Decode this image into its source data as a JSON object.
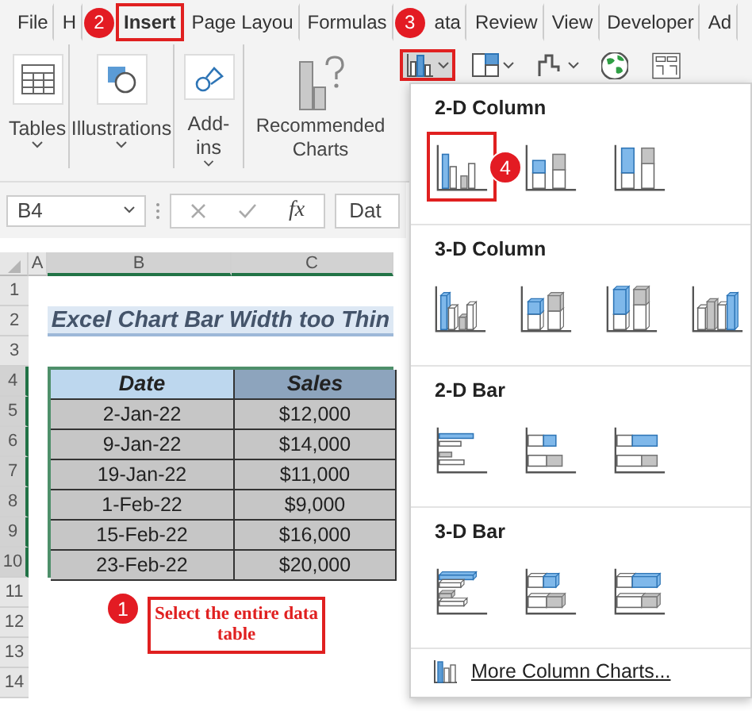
{
  "ribbon_tabs": [
    {
      "label": "File",
      "selected": false
    },
    {
      "label": "H",
      "selected": false
    },
    {
      "label": "Insert",
      "selected": true
    },
    {
      "label": "Page Layou",
      "selected": false
    },
    {
      "label": "Formulas",
      "selected": false
    },
    {
      "label": "ata",
      "selected": false
    },
    {
      "label": "Review",
      "selected": false
    },
    {
      "label": "View",
      "selected": false
    },
    {
      "label": "Developer",
      "selected": false
    },
    {
      "label": "Ad",
      "selected": false
    }
  ],
  "ribbon_groups": [
    {
      "kind": "tables",
      "label": "Tables"
    },
    {
      "kind": "illustrations",
      "label": "Illustrations"
    },
    {
      "kind": "addins",
      "label": "Add-ins"
    },
    {
      "kind": "recommended",
      "label": "Recommended Charts"
    }
  ],
  "chart_buttons": [
    {
      "kind": "column",
      "selected": true
    },
    {
      "kind": "hierarchy",
      "selected": false
    },
    {
      "kind": "waterfall",
      "selected": false
    },
    {
      "kind": "map",
      "selected": false
    },
    {
      "kind": "pivot",
      "selected": false
    }
  ],
  "formula_bar": {
    "name_box": "B4",
    "function_label": "fx",
    "formula": "Dat"
  },
  "sheet": {
    "columns": [
      "A",
      "B",
      "C"
    ],
    "rows": [
      "1",
      "2",
      "3",
      "4",
      "5",
      "6",
      "7",
      "8",
      "9",
      "10",
      "11",
      "12",
      "13",
      "14"
    ],
    "title": "Excel Chart Bar Width too Thin",
    "table": {
      "headers": [
        "Date",
        "Sales"
      ],
      "rows": [
        [
          "2-Jan-22",
          "$12,000"
        ],
        [
          "9-Jan-22",
          "$14,000"
        ],
        [
          "19-Jan-22",
          "$11,000"
        ],
        [
          "1-Feb-22",
          "$9,000"
        ],
        [
          "15-Feb-22",
          "$16,000"
        ],
        [
          "23-Feb-22",
          "$20,000"
        ]
      ]
    },
    "callout": "Select the entire data table"
  },
  "chart_menu": {
    "sections": [
      {
        "title": "2-D Column",
        "items": [
          {
            "kind": "column-clustered",
            "selected": true
          },
          {
            "kind": "column-stacked",
            "selected": false
          },
          {
            "kind": "column-percent",
            "selected": false
          }
        ]
      },
      {
        "title": "3-D Column",
        "items": [
          {
            "kind": "column3d-clustered",
            "selected": false
          },
          {
            "kind": "column3d-stacked",
            "selected": false
          },
          {
            "kind": "column3d-percent",
            "selected": false
          },
          {
            "kind": "column3d-depth",
            "selected": false
          }
        ]
      },
      {
        "title": "2-D Bar",
        "items": [
          {
            "kind": "bar-clustered",
            "selected": false
          },
          {
            "kind": "bar-stacked",
            "selected": false
          },
          {
            "kind": "bar-percent",
            "selected": false
          }
        ]
      },
      {
        "title": "3-D Bar",
        "items": [
          {
            "kind": "bar3d-clustered",
            "selected": false
          },
          {
            "kind": "bar3d-stacked",
            "selected": false
          },
          {
            "kind": "bar3d-percent",
            "selected": false
          }
        ]
      }
    ],
    "more_link": "More Column Charts..."
  },
  "step_markers": [
    "1",
    "2",
    "3",
    "4"
  ]
}
